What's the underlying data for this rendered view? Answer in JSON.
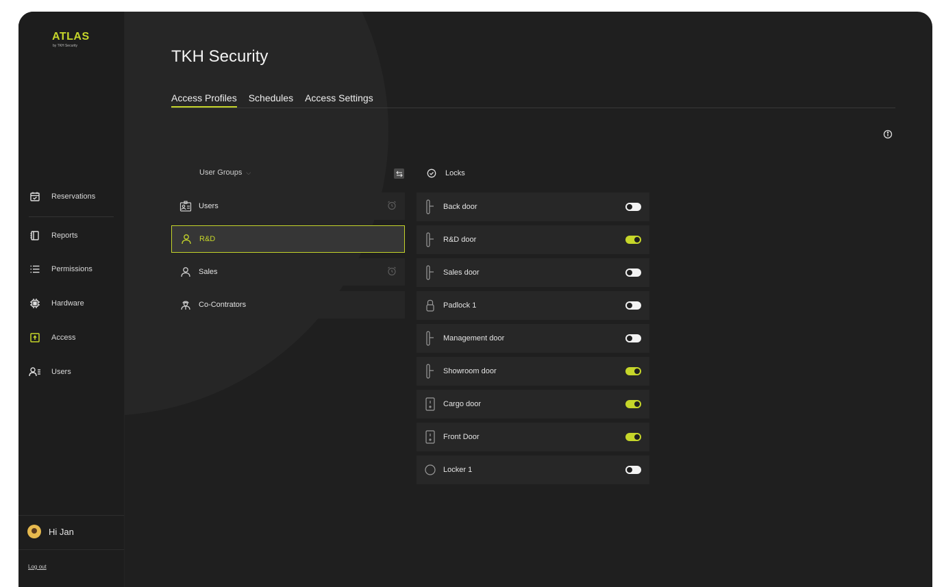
{
  "app": {
    "name": "ATLAS",
    "subtitle": "by TKH Security"
  },
  "colors": {
    "accent": "#c6d62a",
    "background": "#1f1f1f"
  },
  "sidebar": {
    "items": [
      {
        "label": "Reservations",
        "icon": "calendar-icon"
      },
      {
        "label": "Reports",
        "icon": "report-icon"
      },
      {
        "label": "Permissions",
        "icon": "list-icon"
      },
      {
        "label": "Hardware",
        "icon": "chip-icon"
      },
      {
        "label": "Access",
        "icon": "access-icon"
      },
      {
        "label": "Users",
        "icon": "users-icon"
      }
    ],
    "greeting": "Hi Jan",
    "logout": "Log out"
  },
  "main": {
    "title": "TKH Security",
    "tabs": [
      {
        "label": "Access Profiles",
        "active": true
      },
      {
        "label": "Schedules",
        "active": false
      },
      {
        "label": "Access Settings",
        "active": false
      }
    ]
  },
  "groups": {
    "header": "User Groups",
    "items": [
      {
        "label": "Users",
        "icon": "id-card-icon",
        "alarm": true,
        "selected": false
      },
      {
        "label": "R&D",
        "icon": "user-icon",
        "alarm": false,
        "selected": true
      },
      {
        "label": "Sales",
        "icon": "user-icon",
        "alarm": true,
        "selected": false
      },
      {
        "label": "Co-Contrators",
        "icon": "contractor-icon",
        "alarm": false,
        "selected": false
      }
    ]
  },
  "locks": {
    "header": "Locks",
    "items": [
      {
        "label": "Back door",
        "icon": "door-handle-icon",
        "enabled": false
      },
      {
        "label": "R&D door",
        "icon": "door-handle-icon",
        "enabled": true
      },
      {
        "label": "Sales door",
        "icon": "door-handle-icon",
        "enabled": false
      },
      {
        "label": "Padlock 1",
        "icon": "padlock-icon",
        "enabled": false
      },
      {
        "label": "Management door",
        "icon": "door-handle-icon",
        "enabled": false
      },
      {
        "label": "Showroom door",
        "icon": "door-handle-icon",
        "enabled": true
      },
      {
        "label": "Cargo door",
        "icon": "door-panel-icon",
        "enabled": true
      },
      {
        "label": "Front Door",
        "icon": "door-panel-icon",
        "enabled": true
      },
      {
        "label": "Locker 1",
        "icon": "locker-icon",
        "enabled": false
      }
    ]
  }
}
